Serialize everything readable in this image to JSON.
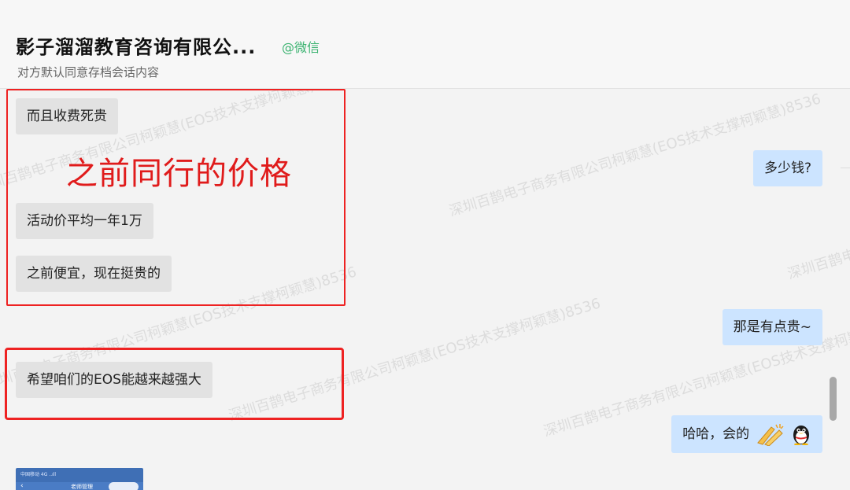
{
  "header": {
    "title": "影子溜溜教育咨询有限公...",
    "source": "@微信",
    "subtitle": "对方默认同意存档会话内容"
  },
  "watermark": "深圳百鹊电子商务有限公司柯颖慧(EOS技术支撑柯颖慧)8536",
  "annotation": {
    "text": "之前同行的价格",
    "color": "#e01b1b"
  },
  "messages": [
    {
      "side": "left",
      "text": "而且收费死贵"
    },
    {
      "side": "right",
      "text": "多少钱?"
    },
    {
      "side": "left",
      "text": "活动价平均一年1万"
    },
    {
      "side": "left",
      "text": "之前便宜，现在挺贵的"
    },
    {
      "side": "right",
      "text": "那是有点贵~"
    },
    {
      "side": "left",
      "text": "希望咱们的EOS能越来越强大"
    },
    {
      "side": "right",
      "text": "哈哈，会的",
      "emojis": [
        "clap-emoji",
        "penguin-emoji"
      ]
    }
  ],
  "thumbnail": {
    "status_text": "中国移动 4G ..ıll",
    "title": "老师管理",
    "back_glyph": "‹"
  },
  "colors": {
    "highlight_border": "#ee2222",
    "right_bubble": "#cce4ff",
    "left_bubble": "#e2e2e2",
    "source_green": "#3cb371"
  }
}
